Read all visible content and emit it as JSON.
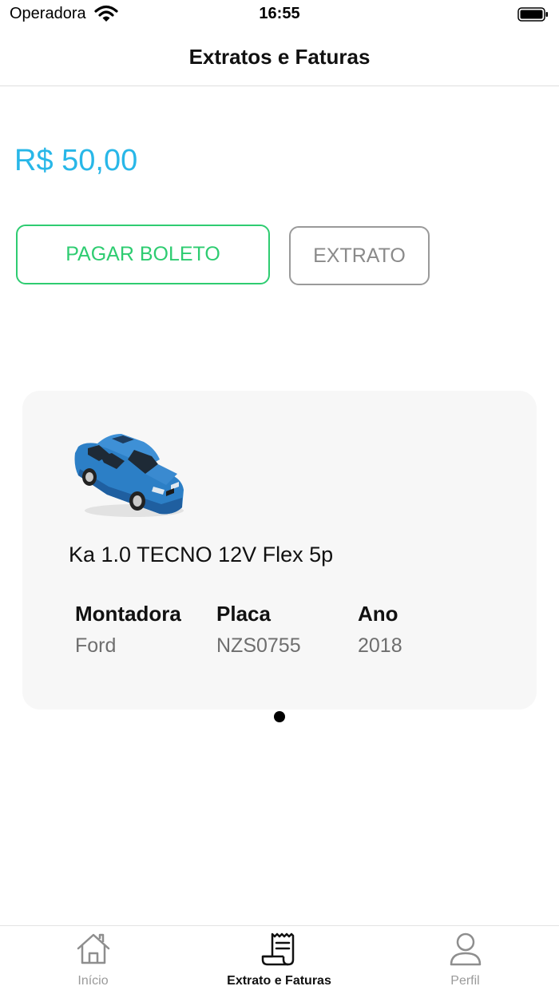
{
  "status_bar": {
    "carrier": "Operadora",
    "time": "16:55"
  },
  "nav": {
    "title": "Extratos e Faturas"
  },
  "balance": {
    "amount": "R$ 50,00",
    "color": "#28b7e8"
  },
  "actions": {
    "pay_label": "PAGAR BOLETO",
    "extract_label": "EXTRATO",
    "pay_color": "#2ecc71",
    "extract_color": "#8a8a8a"
  },
  "vehicle": {
    "icon": "car-icon",
    "model": "Ka 1.0 TECNO 12V Flex 5p",
    "fields": [
      {
        "label": "Montadora",
        "value": "Ford"
      },
      {
        "label": "Placa",
        "value": "NZS0755"
      },
      {
        "label": "Ano",
        "value": "2018"
      }
    ]
  },
  "carousel": {
    "page_count": 1,
    "current_page": 1
  },
  "tab_bar": {
    "tabs": [
      {
        "label": "Início",
        "icon": "home-icon",
        "active": false
      },
      {
        "label": "Extrato e Faturas",
        "icon": "receipt-icon",
        "active": true
      },
      {
        "label": "Perfil",
        "icon": "user-icon",
        "active": false
      }
    ]
  }
}
